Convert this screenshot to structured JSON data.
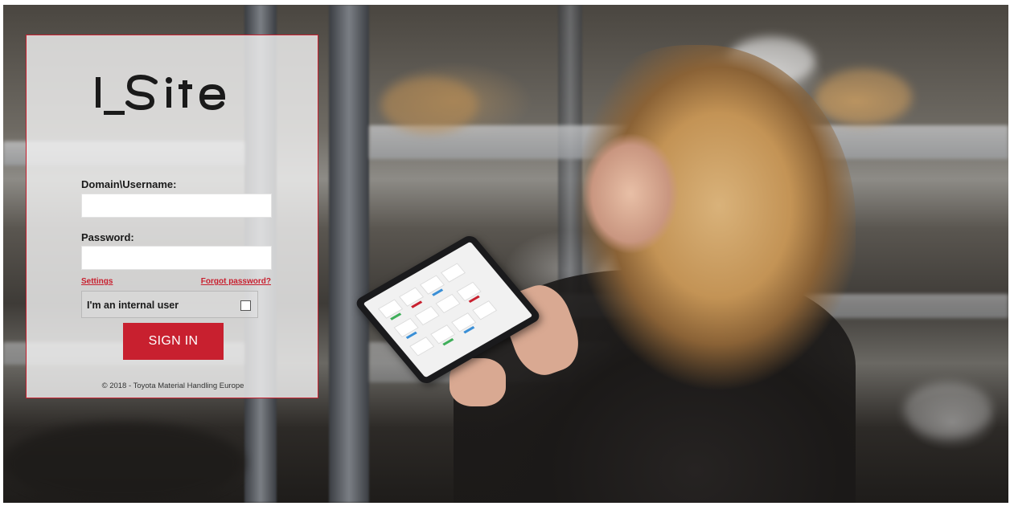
{
  "logo": {
    "text": "I_Site"
  },
  "form": {
    "username_label": "Domain\\Username:",
    "username_value": "",
    "password_label": "Password:",
    "password_value": "",
    "settings_link": "Settings",
    "forgot_link": "Forgot password?",
    "internal_user_label": "I'm an internal user",
    "internal_user_checked": false,
    "sign_in_label": "SIGN IN"
  },
  "footer": {
    "copyright": "© 2018 - Toyota Material Handling Europe"
  },
  "colors": {
    "accent": "#c8202f",
    "panel_bg": "#f0f0f0"
  },
  "icons": {
    "checkbox": "checkbox-icon"
  }
}
